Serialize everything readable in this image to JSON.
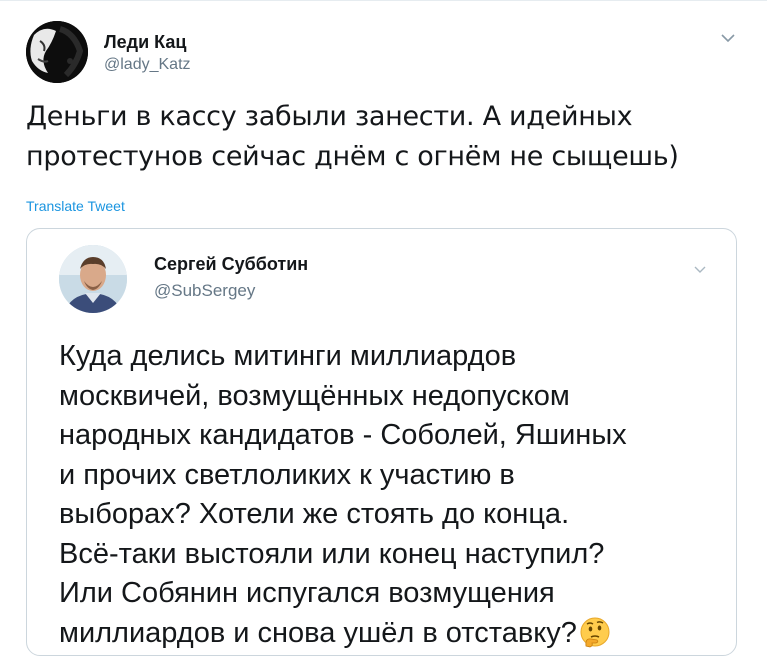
{
  "tweet": {
    "author_name": "Леди Кац",
    "author_handle": "@lady_Katz",
    "text_lines": [
      "Деньги в кассу забыли занести. А идейных",
      "протестунов сейчас днём с огнём не сыщешь)"
    ],
    "translate_label": "Translate Tweet"
  },
  "quoted_tweet": {
    "author_name": "Сергей Субботин",
    "author_handle": "@SubSergey",
    "text_lines": [
      "Куда делись митинги миллиардов",
      "москвичей, возмущённых недопуском",
      "народных кандидатов - Соболей, Яшиных",
      "и прочих светлоликих к участию в",
      "выборах? Хотели же стоять до конца.",
      "Всё-таки выстояли или конец наступил?",
      "Или Собянин испугался возмущения",
      "миллиардов и снова ушёл в отставку?"
    ],
    "emoji": "thinking-face"
  },
  "colors": {
    "text": "#14171a",
    "secondary": "#657786",
    "link": "#1b95e0",
    "border": "#ccd6dd"
  }
}
